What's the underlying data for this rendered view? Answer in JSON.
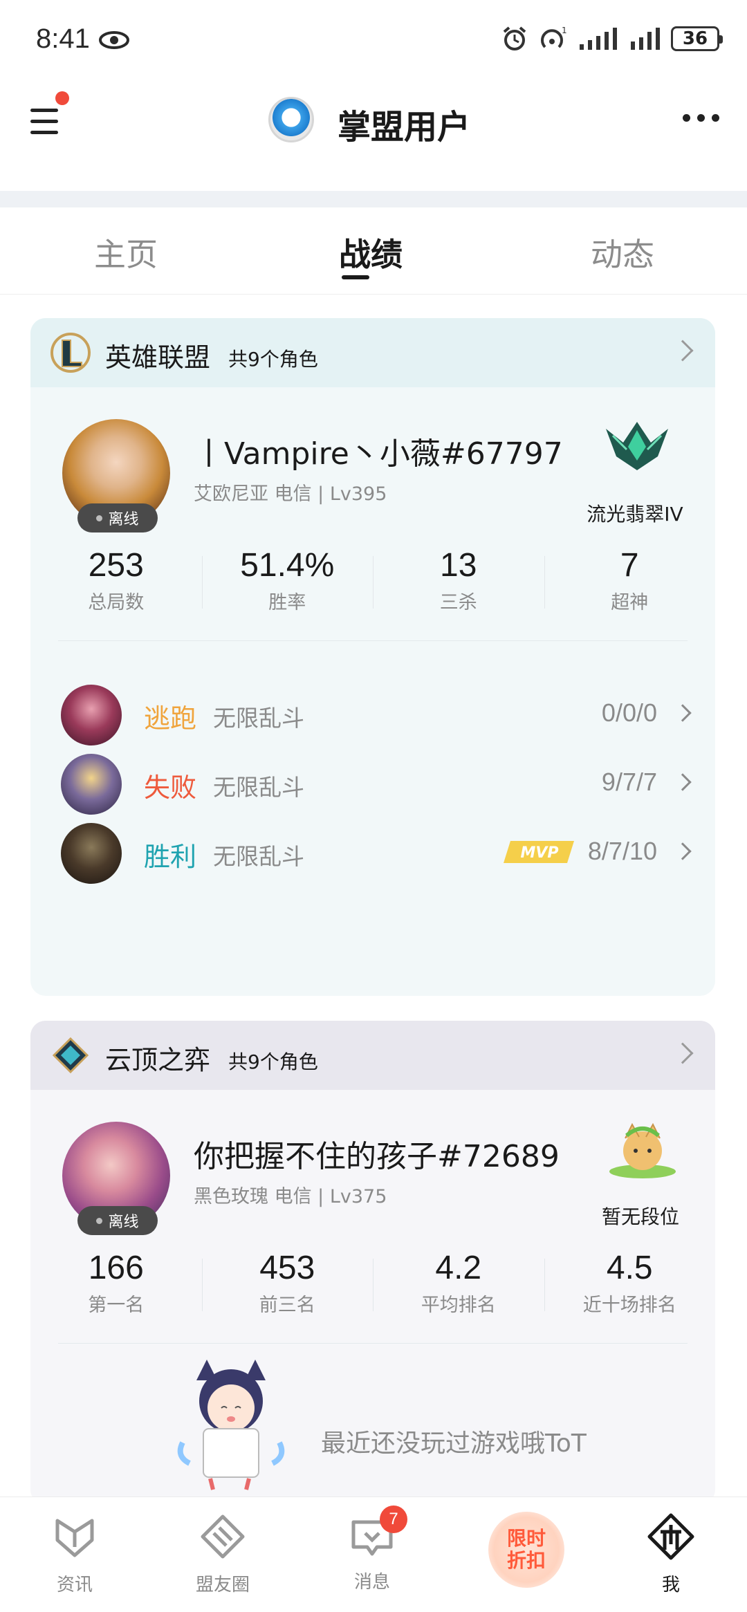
{
  "status_bar": {
    "time": "8:41",
    "battery": "36"
  },
  "header": {
    "title": "掌盟用户"
  },
  "tabs": [
    {
      "label": "主页"
    },
    {
      "label": "战绩"
    },
    {
      "label": "动态"
    }
  ],
  "lol": {
    "game_name": "英雄联盟",
    "role_count": "共9个角色",
    "player_name": "丨Vampire丶小薇#67797",
    "server": "艾欧尼亚",
    "isp_level": "电信 | Lv395",
    "status": "离线",
    "rank": "流光翡翠IV",
    "stats": [
      {
        "value": "253",
        "label": "总局数"
      },
      {
        "value": "51.4%",
        "label": "胜率"
      },
      {
        "value": "13",
        "label": "三杀"
      },
      {
        "value": "7",
        "label": "超神"
      }
    ],
    "matches": [
      {
        "result": "逃跑",
        "result_color": "#f0a43c",
        "mode": "无限乱斗",
        "kda": "0/0/0",
        "mvp": false
      },
      {
        "result": "失败",
        "result_color": "#ee5a3c",
        "mode": "无限乱斗",
        "kda": "9/7/7",
        "mvp": false
      },
      {
        "result": "胜利",
        "result_color": "#1fa3b0",
        "mode": "无限乱斗",
        "kda": "8/7/10",
        "mvp": true
      }
    ]
  },
  "tft": {
    "game_name": "云顶之弈",
    "role_count": "共9个角色",
    "player_name": "你把握不住的孩子#72689",
    "server": "黑色玫瑰",
    "isp_level": "电信 | Lv375",
    "status": "离线",
    "rank": "暂无段位",
    "stats": [
      {
        "value": "166",
        "label": "第一名"
      },
      {
        "value": "453",
        "label": "前三名"
      },
      {
        "value": "4.2",
        "label": "平均排名"
      },
      {
        "value": "4.5",
        "label": "近十场排名"
      }
    ],
    "empty_text": "最近还没玩过游戏哦ToT"
  },
  "bottom_nav": [
    {
      "label": "资讯",
      "icon": "news-icon"
    },
    {
      "label": "盟友圈",
      "icon": "friends-circle-icon"
    },
    {
      "label": "消息",
      "icon": "message-icon",
      "badge": "7"
    },
    {
      "label": "限时折扣",
      "icon": "promo-icon"
    },
    {
      "label": "我",
      "icon": "me-icon"
    }
  ],
  "colors": {
    "accent_red": "#f04a3a",
    "win": "#1fa3b0",
    "lose": "#ee5a3c",
    "escape": "#f0a43c"
  }
}
